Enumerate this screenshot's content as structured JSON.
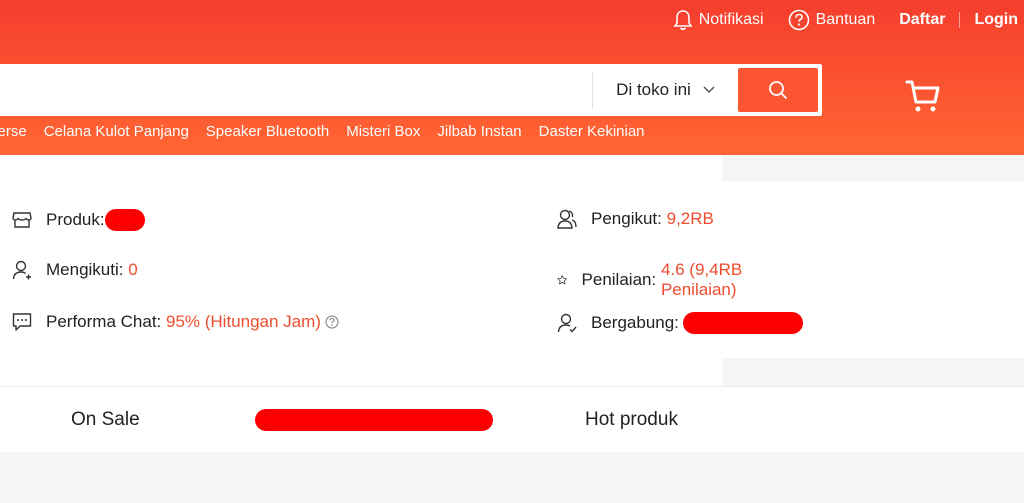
{
  "topbar": {
    "notifications_label": "Notifikasi",
    "help_label": "Bantuan",
    "register_label": "Daftar",
    "login_label": "Login"
  },
  "search": {
    "placeholder": "",
    "scope_label": "Di toko ini"
  },
  "keywords": [
    "verse",
    "Celana Kulot Panjang",
    "Speaker Bluetooth",
    "Misteri Box",
    "Jilbab Instan",
    "Daster Kekinian"
  ],
  "shop_stats": {
    "products_label": "Produk:",
    "following_label": "Mengikuti:",
    "following_value": "0",
    "chat_label": "Performa Chat:",
    "chat_value": "95% (Hitungan Jam)",
    "followers_label": "Pengikut:",
    "followers_value": "9,2RB",
    "rating_label": "Penilaian:",
    "rating_value": "4.6 (9,4RB Penilaian)",
    "joined_label": "Bergabung:"
  },
  "tabs": {
    "on_sale": "On Sale",
    "hot_products": "Hot produk"
  },
  "colors": {
    "brand": "#ee4d2d",
    "redaction": "#ff0000"
  },
  "icons": [
    "bell-icon",
    "help-circle-icon",
    "search-icon",
    "chevron-down-icon",
    "cart-icon",
    "store-icon",
    "person-add-icon",
    "chat-icon",
    "followers-icon",
    "star-icon",
    "person-check-icon",
    "question-icon"
  ]
}
